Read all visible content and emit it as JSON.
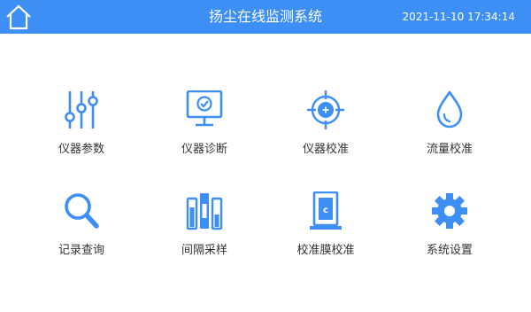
{
  "header": {
    "title": "扬尘在线监测系统",
    "datetime": "2021-11-10 17:34:14",
    "home_icon": "home-icon",
    "background_color": "#3d8ef5"
  },
  "menu": {
    "accent_color": "#3d8ef5",
    "items": [
      {
        "label": "仪器参数",
        "icon": "sliders-icon"
      },
      {
        "label": "仪器诊断",
        "icon": "monitor-check-icon"
      },
      {
        "label": "仪器校准",
        "icon": "crosshair-icon"
      },
      {
        "label": "流量校准",
        "icon": "droplet-icon"
      },
      {
        "label": "记录查询",
        "icon": "search-icon"
      },
      {
        "label": "间隔采样",
        "icon": "sample-tubes-icon"
      },
      {
        "label": "校准膜校准",
        "icon": "calibration-film-icon"
      },
      {
        "label": "系统设置",
        "icon": "gear-icon"
      }
    ],
    "film_icon_letter": "c"
  }
}
